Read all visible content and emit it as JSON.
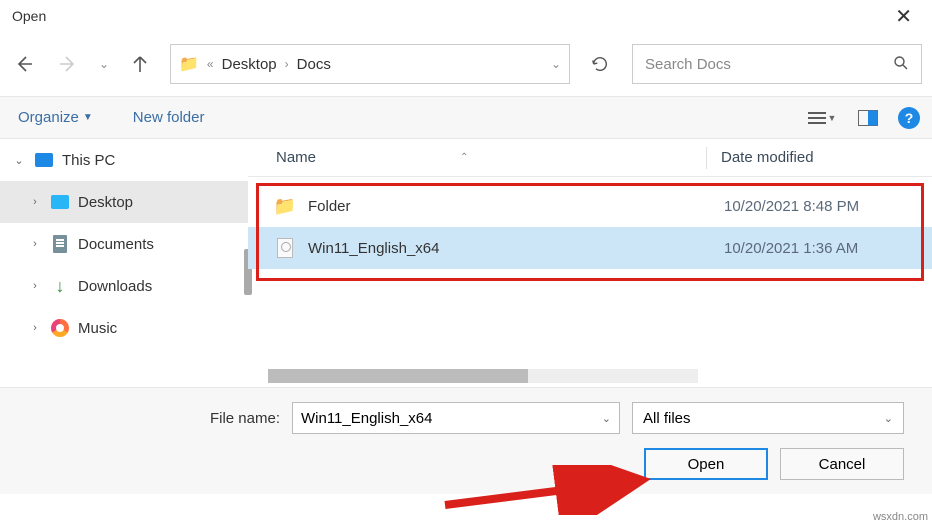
{
  "titlebar": {
    "title": "Open"
  },
  "breadcrumb": {
    "seg1": "Desktop",
    "seg2": "Docs"
  },
  "search": {
    "placeholder": "Search Docs"
  },
  "toolbar": {
    "organize": "Organize",
    "newfolder": "New folder"
  },
  "sidebar": {
    "items": [
      {
        "label": "This PC"
      },
      {
        "label": "Desktop"
      },
      {
        "label": "Documents"
      },
      {
        "label": "Downloads"
      },
      {
        "label": "Music"
      }
    ]
  },
  "columns": {
    "name": "Name",
    "date": "Date modified"
  },
  "files": [
    {
      "name": "Folder",
      "date": "10/20/2021 8:48 PM"
    },
    {
      "name": "Win11_English_x64",
      "date": "10/20/2021 1:36 AM"
    }
  ],
  "footer": {
    "label": "File name:",
    "value": "Win11_English_x64",
    "filter": "All files",
    "open": "Open",
    "cancel": "Cancel"
  },
  "watermark": "wsxdn.com"
}
